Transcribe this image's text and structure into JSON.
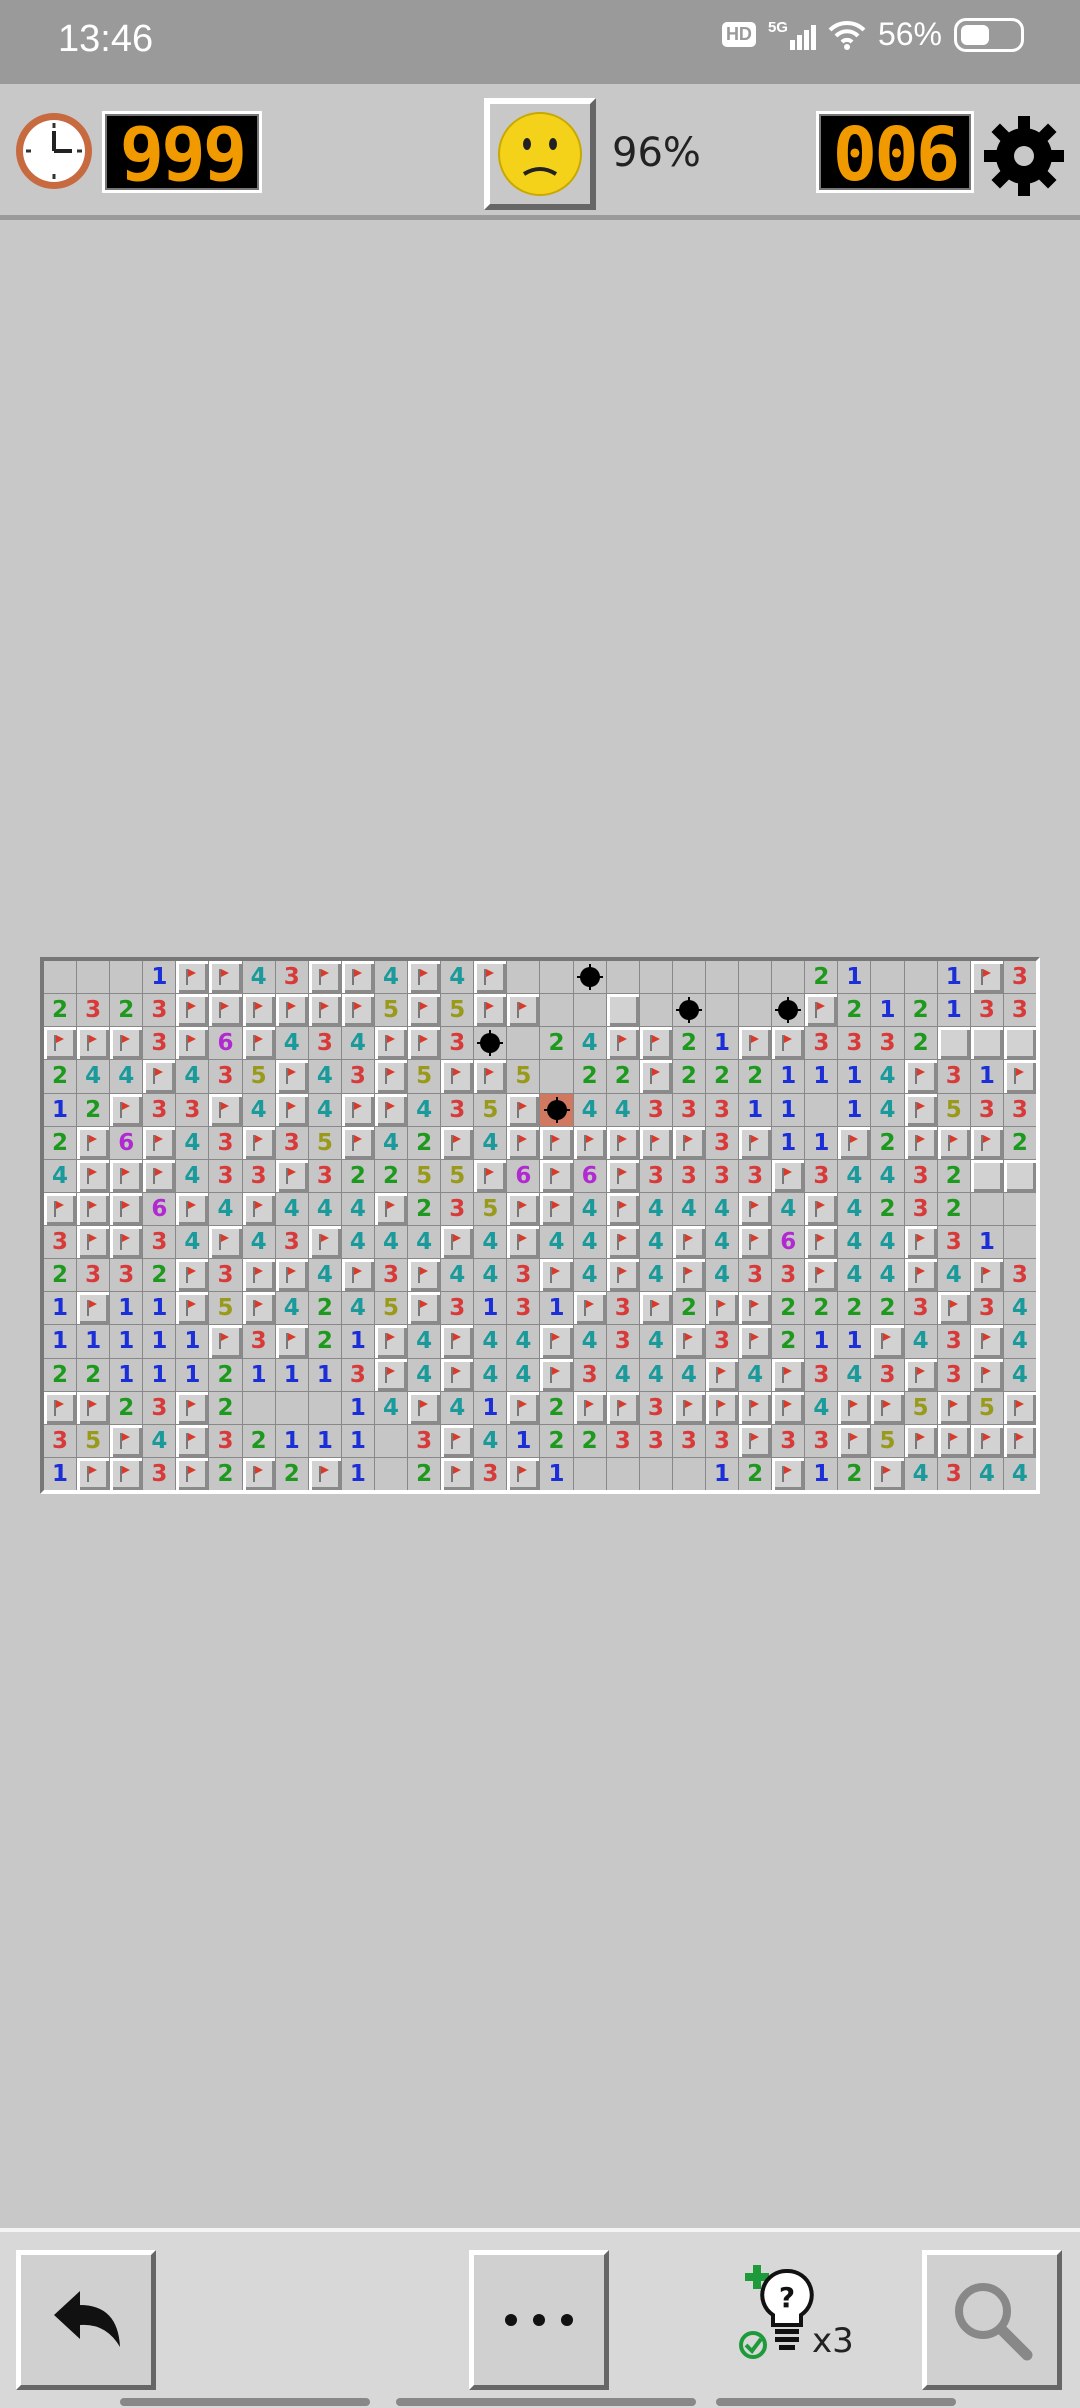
{
  "status_bar": {
    "time": "13:46",
    "network_badge": "HD",
    "network_type": "5G",
    "battery": "56%"
  },
  "header": {
    "timer_value": "999",
    "mines_left": "006",
    "completion": "96%",
    "face_state": "worried"
  },
  "board": {
    "columns": 30,
    "rows": 16,
    "legend": {
      "_": "empty-open",
      "#": "covered",
      "F": "flagged",
      "*": "mine",
      "X": "exploded-mine",
      "1-8": "adjacent count"
    },
    "grid": [
      "___1FF43FF4F4F__*______21__1F321",
      "2323FFFFFF5F5FF__#_*__*F2121331",
      "FFF3F6F434FF3*_24FF21FF3332",
      "244F435F43F5FF5_22F2221114F31F1",
      "12F33F4F4FF435FX4433311_14F5332",
      "2F6F43F35F42F4FFFFFF3F11F2FFF2F",
      "4FFF433F32255F6F6F3333F34432",
      "FFF6F4F444F235FF4F444F4F4232__",
      "3FF34F43F444F4F44F4F4F6F44F31_",
      "2332F3FF4F3F443F4F4F433F44F4F31",
      "1F11F5F4245F3131F3F2FF22223F34F2",
      "11111F3F21F4F44F434F3F211F43F4",
      "2211121113F4F44F3444F4F343F3F4F",
      "FF23F2___14F41F2FF3FFFF4FF5F5F5F",
      "35F4F32111_3F41223333F33F5FFFFF2",
      "1FF3F2F2F1_2F3F1____12F12F4344F31"
    ]
  },
  "bottom_bar": {
    "hint_count": "x3"
  }
}
